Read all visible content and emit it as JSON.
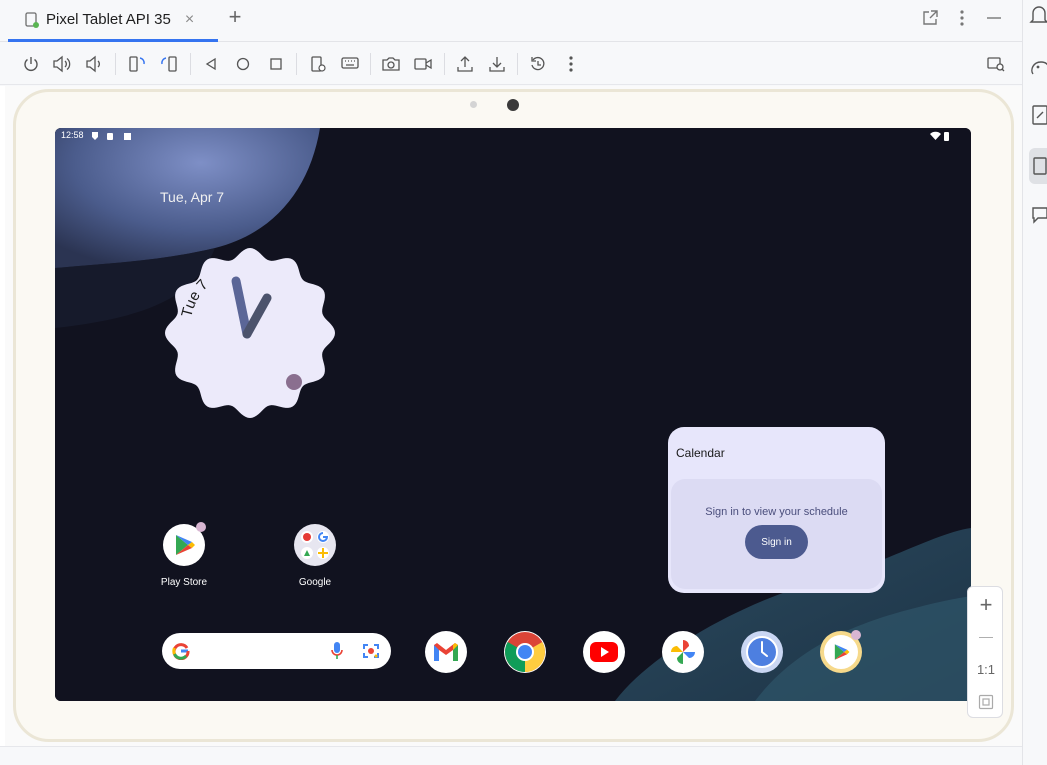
{
  "tab": {
    "title": "Pixel Tablet API 35",
    "close": "×",
    "new": "+"
  },
  "icons": {
    "tabbar_right": [
      "open-external-icon",
      "more-vertical-icon",
      "minimize-icon"
    ],
    "toolbar": [
      "power-icon",
      "volume-up-icon",
      "volume-down-icon",
      "rotate-left-icon",
      "rotate-right-icon",
      "back-icon",
      "home-icon",
      "overview-icon",
      "device-settings-icon",
      "keyboard-icon",
      "screenshot-icon",
      "screen-record-icon",
      "upload-icon",
      "download-icon",
      "reset-icon",
      "more-vertical-icon",
      "device-mirror-icon"
    ],
    "sidebar": [
      "notifications-icon",
      "palette-icon",
      "device-file-icon",
      "running-devices-icon",
      "chat-icon"
    ]
  },
  "device": {
    "status_time": "12:58",
    "date": "Tue, Apr 7",
    "clock_day": "Tue 7",
    "apps": [
      {
        "label": "Play Store",
        "icon": "play-store-icon"
      },
      {
        "label": "Google",
        "icon": "google-folder-icon"
      }
    ],
    "dock": [
      "gmail-icon",
      "chrome-icon",
      "youtube-icon",
      "photos-icon",
      "clock-icon",
      "play-games-icon"
    ],
    "widget": {
      "title": "Calendar",
      "message": "Sign in to view your schedule",
      "button": "Sign in"
    }
  },
  "zoom": {
    "in": "+",
    "out": "—",
    "reset": "1:1"
  },
  "colors": {
    "accent": "#3574f0",
    "screen_bg": "#11121f",
    "widget_bg": "#e7e6fb",
    "widget_button": "#4c5a8f",
    "clock_face": "#eceafa",
    "clock_hand": "#5b6697"
  }
}
